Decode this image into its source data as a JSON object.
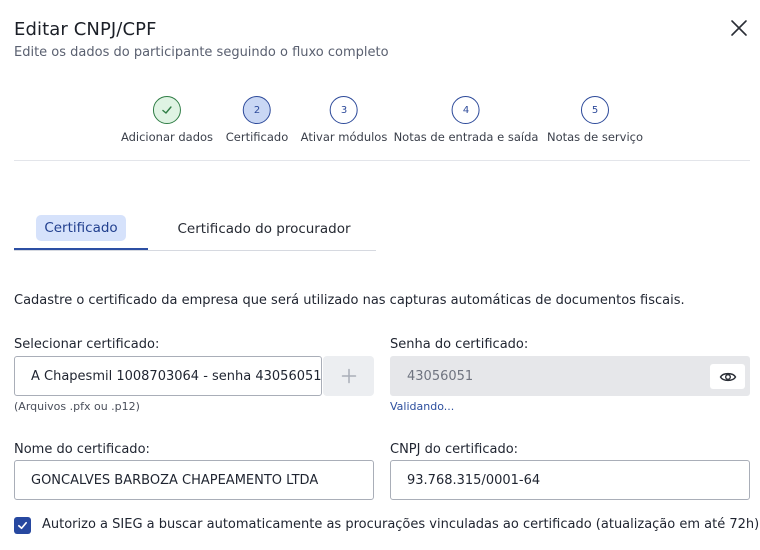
{
  "header": {
    "title": "Editar CNPJ/CPF",
    "subtitle": "Edite os dados do participante seguindo o fluxo completo"
  },
  "stepper": {
    "steps": [
      {
        "number": "",
        "label": "Adicionar dados",
        "state": "done"
      },
      {
        "number": "2",
        "label": "Certificado",
        "state": "active"
      },
      {
        "number": "3",
        "label": "Ativar módulos",
        "state": "pending"
      },
      {
        "number": "4",
        "label": "Notas de entrada e saída",
        "state": "pending"
      },
      {
        "number": "5",
        "label": "Notas de serviço",
        "state": "pending"
      }
    ]
  },
  "tabs": [
    {
      "label": "Certificado",
      "selected": true
    },
    {
      "label": "Certificado do procurador",
      "selected": false
    }
  ],
  "form": {
    "description": "Cadastre o certificado da empresa que será utilizado nas capturas automáticas de documentos fiscais.",
    "select_cert": {
      "label": "Selecionar certificado:",
      "value": "A Chapesmil 1008703064 - senha 43056051",
      "hint": "(Arquivos .pfx ou .p12)"
    },
    "password": {
      "label": "Senha do certificado:",
      "value": "43056051",
      "status": "Validando..."
    },
    "cert_name": {
      "label": "Nome do certificado:",
      "value": "GONCALVES BARBOZA CHAPEAMENTO LTDA"
    },
    "cert_cnpj": {
      "label": "CNPJ do certificado:",
      "value": "93.768.315/0001-64"
    },
    "authorize": {
      "checked": true,
      "label": "Autorizo a SIEG a buscar automaticamente as procurações vinculadas ao certificado (atualização em até 72h)."
    }
  },
  "colors": {
    "primary": "#2748a0",
    "success": "#2f7d45",
    "tab_highlight": "#d6e2fb"
  }
}
